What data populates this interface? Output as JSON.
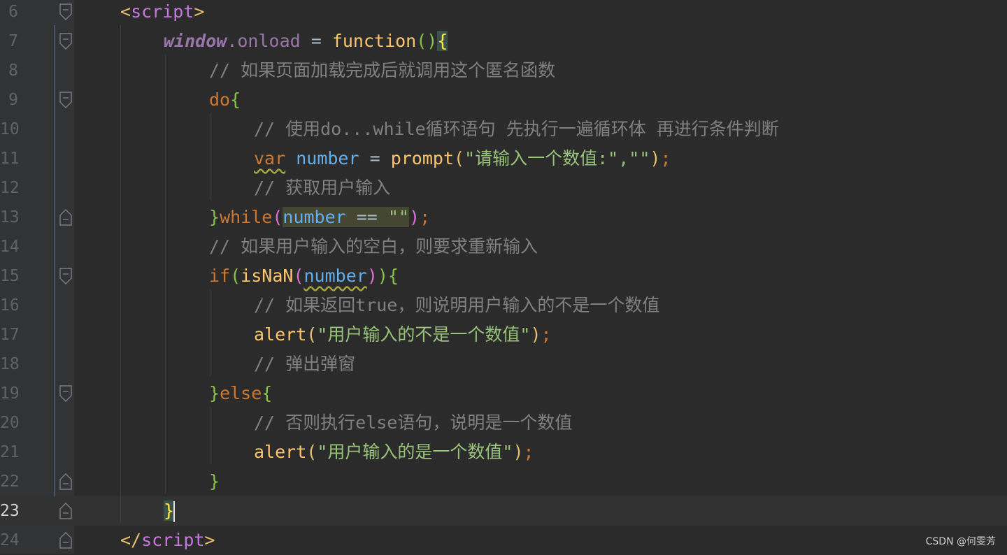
{
  "editor": {
    "lines": [
      {
        "n": "6",
        "tokens": [
          {
            "t": "<",
            "c": "t-punc"
          },
          {
            "t": "script",
            "c": "t-tag"
          },
          {
            "t": ">",
            "c": "t-punc"
          }
        ],
        "indent": 172,
        "fold": "open"
      },
      {
        "n": "7",
        "tokens": [
          {
            "t": "window",
            "c": "t-win"
          },
          {
            "t": ".onload",
            "c": "t-prop"
          },
          {
            "t": " = ",
            "c": "t-op"
          },
          {
            "t": "function",
            "c": "t-fn"
          },
          {
            "t": "()",
            "c": "t-brace-g"
          },
          {
            "t": "{",
            "c": "t-brace-y bracket-hl"
          }
        ],
        "indent": 234,
        "fold": "open"
      },
      {
        "n": "8",
        "tokens": [
          {
            "t": "// 如果页面加载完成后就调用这个匿名函数",
            "c": "t-cmt"
          }
        ],
        "indent": 299,
        "fold": ""
      },
      {
        "n": "9",
        "tokens": [
          {
            "t": "do",
            "c": "t-kw"
          },
          {
            "t": "{",
            "c": "t-brace-g"
          }
        ],
        "indent": 299,
        "fold": "open"
      },
      {
        "n": "10",
        "tokens": [
          {
            "t": "// 使用do...while循环语句 先执行一遍循环体 再进行条件判断",
            "c": "t-cmt"
          }
        ],
        "indent": 363,
        "fold": ""
      },
      {
        "n": "11",
        "tokens": [
          {
            "t": "var",
            "c": "t-kw wavy"
          },
          {
            "t": " ",
            "c": "t-plain"
          },
          {
            "t": "number",
            "c": "t-var"
          },
          {
            "t": " = ",
            "c": "t-op"
          },
          {
            "t": "prompt",
            "c": "t-fn"
          },
          {
            "t": "(",
            "c": "t-punc"
          },
          {
            "t": "\"请输入一个数值:\",\"\"",
            "c": "t-str"
          },
          {
            "t": ")",
            "c": "t-punc"
          },
          {
            "t": ";",
            "c": "t-semi"
          }
        ],
        "indent": 363,
        "fold": ""
      },
      {
        "n": "12",
        "tokens": [
          {
            "t": "// 获取用户输入",
            "c": "t-cmt"
          }
        ],
        "indent": 363,
        "fold": ""
      },
      {
        "n": "13",
        "tokens": [
          {
            "t": "}",
            "c": "t-brace-g"
          },
          {
            "t": "while",
            "c": "t-kw"
          },
          {
            "t": "(",
            "c": "t-brace-m"
          },
          {
            "t": "number",
            "c": "t-var hl-bg"
          },
          {
            "t": " == ",
            "c": "t-op hl-bg"
          },
          {
            "t": "\"\"",
            "c": "t-str hl-bg"
          },
          {
            "t": ")",
            "c": "t-brace-m"
          },
          {
            "t": ";",
            "c": "t-semi"
          }
        ],
        "indent": 299,
        "fold": "close"
      },
      {
        "n": "14",
        "tokens": [
          {
            "t": "// 如果用户输入的空白，则要求重新输入",
            "c": "t-cmt"
          }
        ],
        "indent": 299,
        "fold": ""
      },
      {
        "n": "15",
        "tokens": [
          {
            "t": "if",
            "c": "t-kw"
          },
          {
            "t": "(",
            "c": "t-brace-g"
          },
          {
            "t": "isNaN",
            "c": "t-fn"
          },
          {
            "t": "(",
            "c": "t-brace-m"
          },
          {
            "t": "number",
            "c": "t-var wavy"
          },
          {
            "t": ")",
            "c": "t-brace-m"
          },
          {
            "t": ")",
            "c": "t-brace-g"
          },
          {
            "t": "{",
            "c": "t-brace-g"
          }
        ],
        "indent": 299,
        "fold": "open"
      },
      {
        "n": "16",
        "tokens": [
          {
            "t": "// 如果返回true，则说明用户输入的不是一个数值",
            "c": "t-cmt"
          }
        ],
        "indent": 363,
        "fold": ""
      },
      {
        "n": "17",
        "tokens": [
          {
            "t": "alert",
            "c": "t-fn"
          },
          {
            "t": "(",
            "c": "t-punc"
          },
          {
            "t": "\"用户输入的不是一个数值\"",
            "c": "t-str"
          },
          {
            "t": ")",
            "c": "t-punc"
          },
          {
            "t": ";",
            "c": "t-semi"
          }
        ],
        "indent": 363,
        "fold": ""
      },
      {
        "n": "18",
        "tokens": [
          {
            "t": "// 弹出弹窗",
            "c": "t-cmt"
          }
        ],
        "indent": 363,
        "fold": ""
      },
      {
        "n": "19",
        "tokens": [
          {
            "t": "}",
            "c": "t-brace-g"
          },
          {
            "t": "else",
            "c": "t-kw"
          },
          {
            "t": "{",
            "c": "t-brace-g"
          }
        ],
        "indent": 299,
        "fold": "open"
      },
      {
        "n": "20",
        "tokens": [
          {
            "t": "// 否则执行else语句，说明是一个数值",
            "c": "t-cmt"
          }
        ],
        "indent": 363,
        "fold": ""
      },
      {
        "n": "21",
        "tokens": [
          {
            "t": "alert",
            "c": "t-fn"
          },
          {
            "t": "(",
            "c": "t-punc"
          },
          {
            "t": "\"用户输入的是一个数值\"",
            "c": "t-str"
          },
          {
            "t": ")",
            "c": "t-punc"
          },
          {
            "t": ";",
            "c": "t-semi"
          }
        ],
        "indent": 363,
        "fold": ""
      },
      {
        "n": "22",
        "tokens": [
          {
            "t": "}",
            "c": "t-brace-g"
          }
        ],
        "indent": 299,
        "fold": "close"
      },
      {
        "n": "23",
        "tokens": [
          {
            "t": "}",
            "c": "t-brace-y bracket-hl"
          }
        ],
        "indent": 234,
        "fold": "close",
        "current": true,
        "caret": true
      },
      {
        "n": "24",
        "tokens": [
          {
            "t": "</",
            "c": "t-punc"
          },
          {
            "t": "script",
            "c": "t-tag"
          },
          {
            "t": ">",
            "c": "t-punc"
          }
        ],
        "indent": 172,
        "fold": "close"
      }
    ]
  },
  "watermark": "CSDN @何雯芳"
}
